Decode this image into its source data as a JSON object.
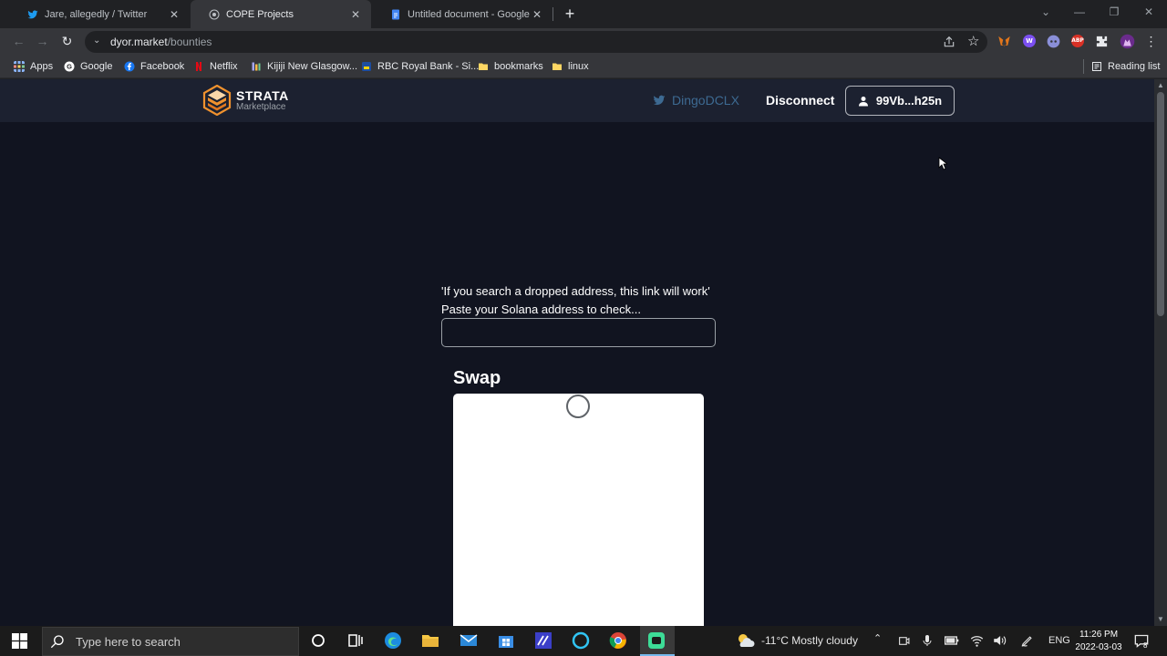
{
  "tabs": [
    {
      "title": "Jare, allegedly / Twitter",
      "active": false
    },
    {
      "title": "COPE Projects",
      "active": true
    },
    {
      "title": "Untitled document - Google Doc",
      "active": false
    }
  ],
  "toolbar": {
    "url_host": "dyor.market",
    "url_path": "/bounties"
  },
  "extensions": [
    "metamask-icon",
    "w-extension-icon",
    "discord-extension-icon",
    "adblock-plus-icon",
    "puzzle-icon",
    "profile-avatar"
  ],
  "extension_labels": {
    "w": "W",
    "abp": "ABP"
  },
  "bookmarks": {
    "apps": "Apps",
    "items": [
      "Google",
      "Facebook",
      "Netflix",
      "Kijiji New Glasgow...",
      "RBC Royal Bank - Si...",
      "bookmarks",
      "linux"
    ],
    "reading_list": "Reading list"
  },
  "site": {
    "logo_name": "STRATA",
    "logo_sub": "Marketplace",
    "twitter_handle": "DingoDCLX",
    "disconnect": "Disconnect",
    "wallet": "99Vb...h25n"
  },
  "main": {
    "notice": "'If you search a dropped address, this link will work'",
    "address_label": "Paste your Solana address to check...",
    "address_value": "",
    "swap_title": "Swap"
  },
  "taskbar": {
    "search_placeholder": "Type here to search",
    "weather": "-11°C  Mostly cloudy",
    "language": "ENG",
    "time": "11:26 PM",
    "date": "2022-03-03",
    "notification_count": "8"
  },
  "colors": {
    "page_bg": "#111420",
    "navbar_bg": "#1c2130",
    "accent_twitter": "#3d6a92",
    "logo_orange": "#f0922e"
  }
}
